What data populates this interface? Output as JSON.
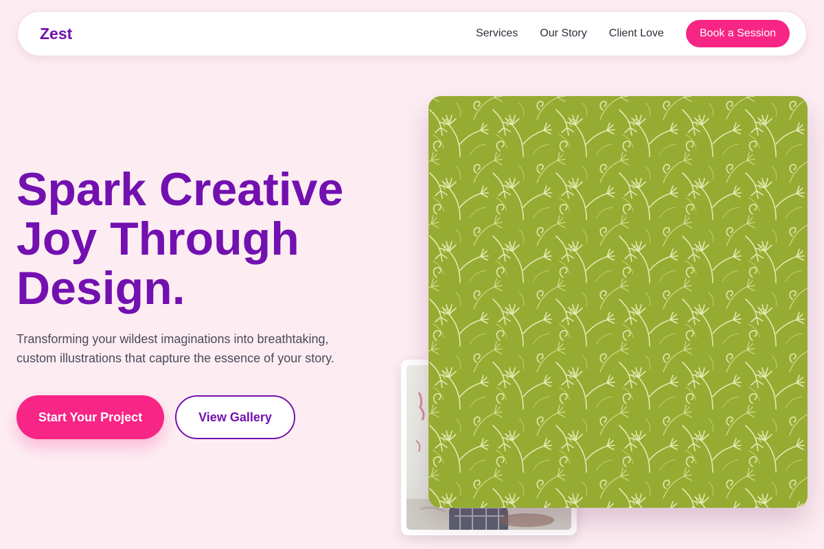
{
  "brand": {
    "name": "Zest",
    "primary_color": "#7210b0",
    "accent_color": "#f72585",
    "background_color": "#fdedf3"
  },
  "nav": {
    "links": [
      {
        "label": "Services"
      },
      {
        "label": "Our Story"
      },
      {
        "label": "Client Love"
      }
    ],
    "cta_label": "Book a Session"
  },
  "hero": {
    "headline": "Spark Creative Joy Through Design.",
    "subtext": "Transforming your wildest imaginations into breathtaking, custom illustrations that capture the essence of your story.",
    "primary_button": "Start Your Project",
    "secondary_button": "View Gallery"
  },
  "gallery": {
    "featured_artwork": "green-floral-pattern-artwork",
    "secondary_artwork": "sketch-illustration-artwork"
  }
}
